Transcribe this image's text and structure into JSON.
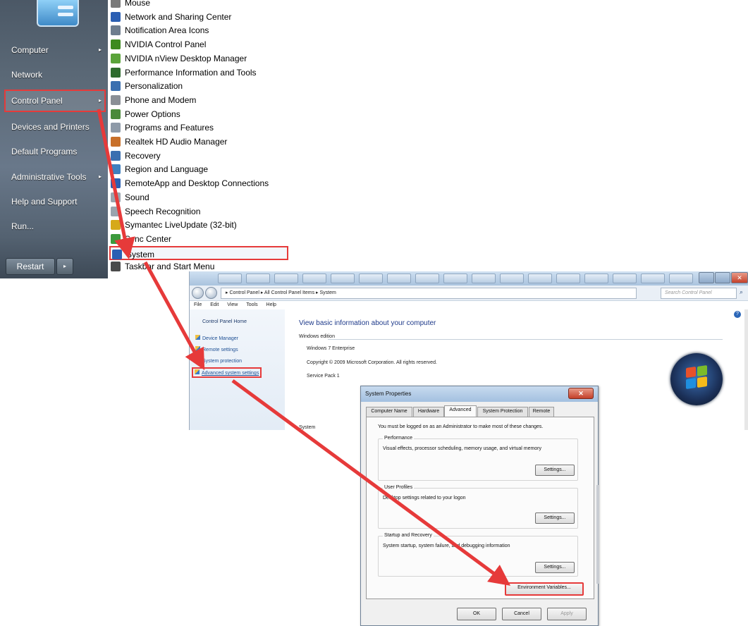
{
  "start_menu": {
    "items": [
      {
        "label": "Computer",
        "has_arrow": true
      },
      {
        "label": "Network",
        "has_arrow": false
      },
      {
        "label": "Control Panel",
        "has_arrow": true
      },
      {
        "label": "Devices and Printers",
        "has_arrow": false
      },
      {
        "label": "Default Programs",
        "has_arrow": false
      },
      {
        "label": "Administrative Tools",
        "has_arrow": true
      },
      {
        "label": "Help and Support",
        "has_arrow": false
      },
      {
        "label": "Run...",
        "has_arrow": false
      }
    ],
    "restart_label": "Restart",
    "arrow_glyph": "▸"
  },
  "control_panel_items": [
    {
      "label": "Mouse",
      "icon": "mouse-icon",
      "color": "#7a7a7a"
    },
    {
      "label": "Network and Sharing Center",
      "icon": "network-icon",
      "color": "#2b5fb3"
    },
    {
      "label": "Notification Area Icons",
      "icon": "notification-icon",
      "color": "#6e7d8e"
    },
    {
      "label": "NVIDIA Control Panel",
      "icon": "nvidia-icon",
      "color": "#3d8a1f"
    },
    {
      "label": "NVIDIA nView Desktop Manager",
      "icon": "nview-icon",
      "color": "#5aa33a"
    },
    {
      "label": "Performance Information and Tools",
      "icon": "performance-icon",
      "color": "#2e6b2e"
    },
    {
      "label": "Personalization",
      "icon": "personalization-icon",
      "color": "#3a6fb0"
    },
    {
      "label": "Phone and Modem",
      "icon": "phone-icon",
      "color": "#8a8f96"
    },
    {
      "label": "Power Options",
      "icon": "power-icon",
      "color": "#4a8a3a"
    },
    {
      "label": "Programs and Features",
      "icon": "programs-icon",
      "color": "#8e9aa8"
    },
    {
      "label": "Realtek HD Audio Manager",
      "icon": "audio-icon",
      "color": "#c8702a"
    },
    {
      "label": "Recovery",
      "icon": "recovery-icon",
      "color": "#3a6fb0"
    },
    {
      "label": "Region and Language",
      "icon": "region-icon",
      "color": "#3f7fbf"
    },
    {
      "label": "RemoteApp and Desktop Connections",
      "icon": "remoteapp-icon",
      "color": "#2b5fb3"
    },
    {
      "label": "Sound",
      "icon": "sound-icon",
      "color": "#9aa4ae"
    },
    {
      "label": "Speech Recognition",
      "icon": "speech-icon",
      "color": "#9aa4ae"
    },
    {
      "label": "Symantec LiveUpdate (32-bit)",
      "icon": "symantec-icon",
      "color": "#d6a91a"
    },
    {
      "label": "Sync Center",
      "icon": "sync-icon",
      "color": "#3c9a3c"
    },
    {
      "label": "System",
      "icon": "system-icon",
      "color": "#2b5fb3"
    },
    {
      "label": "Taskbar and Start Menu",
      "icon": "taskbar-icon",
      "color": "#4a4a4a"
    }
  ],
  "cp_window": {
    "address": "▸ Control Panel ▸ All Control Panel Items ▸ System",
    "search_placeholder": "Search Control Panel",
    "menu": [
      "File",
      "Edit",
      "View",
      "Tools",
      "Help"
    ],
    "left_links": {
      "home": "Control Panel Home",
      "device_manager": "Device Manager",
      "remote_settings": "Remote settings",
      "system_protection": "System protection",
      "advanced": "Advanced system settings"
    },
    "heading": "View basic information about your computer",
    "edition_label": "Windows edition",
    "edition": "Windows 7 Enterprise",
    "copyright": "Copyright © 2009 Microsoft Corporation.  All rights reserved.",
    "service_pack": "Service Pack 1",
    "system_label": "System"
  },
  "system_properties": {
    "title": "System Properties",
    "close_glyph": "✕",
    "tabs": [
      "Computer Name",
      "Hardware",
      "Advanced",
      "System Protection",
      "Remote"
    ],
    "admin_note": "You must be logged on as an Administrator to make most of these changes.",
    "performance_title": "Performance",
    "performance_desc": "Visual effects, processor scheduling, memory usage, and virtual memory",
    "user_profiles_title": "User Profiles",
    "user_profiles_desc": "Desktop settings related to your logon",
    "startup_title": "Startup and Recovery",
    "startup_desc": "System startup, system failure, and debugging information",
    "settings_label": "Settings...",
    "env_label": "Environment Variables...",
    "ok_label": "OK",
    "cancel_label": "Cancel",
    "apply_label": "Apply"
  },
  "colors": {
    "highlight": "#e63a3a",
    "link": "#1e4f94",
    "heading": "#1e3a8a"
  }
}
